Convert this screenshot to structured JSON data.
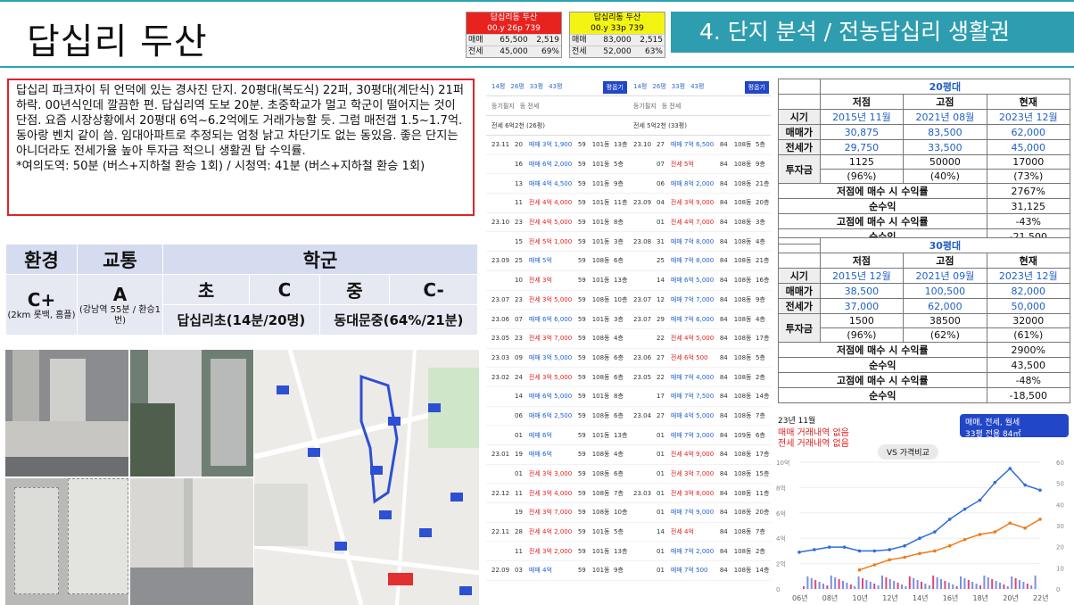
{
  "header": {
    "title": "답십리 두산",
    "section": "4. 단지 분석 / 전농답십리 생활권"
  },
  "mini_cards": [
    {
      "name": "답십리동 두산",
      "info": "00.y  26p  739",
      "rows": [
        [
          "매매",
          "65,500",
          "2,519"
        ],
        [
          "전세",
          "45,000",
          "69%"
        ]
      ],
      "color": "#e8231f",
      "text": "#ffffff"
    },
    {
      "name": "답십리동 두산",
      "info": "00.y  33p  739",
      "rows": [
        [
          "매매",
          "83,000",
          "2,515"
        ],
        [
          "전세",
          "52,000",
          "63%"
        ]
      ],
      "color": "#f4f413",
      "text": "#000000"
    }
  ],
  "description": "답십리 파크자이 뒤 언덕에 있는 경사진 단지. 20평대(복도식) 22퍼, 30평대(계단식) 21퍼 하락. 00년식인데 깔끔한 편. 답십리역 도보 20분. 초중학교가 멀고 학군이 떨어지는 것이 단점. 요즘 시장상황에서 20평대 6억~6.2억에도 거래가능할 듯. 그럼 매전갭 1.5~1.7억. 동아랑 벤치 같이 씀. 임대아파트로 추정되는 엄청 낡고 차단기도 없는 동있음. 좋은 단지는 아니더라도 전세가율 높아 투자금 적으니 생활권 탑 수익률.",
  "commute": "*여의도역: 50분 (버스+지하철 환승 1회) / 시청역: 41분 (버스+지하철 환승 1회)",
  "env_table": {
    "headers": [
      "환경",
      "교통",
      "학군"
    ],
    "grades": {
      "env": "C+",
      "traffic": "A",
      "elem": "초",
      "elem_grade": "C",
      "mid": "중",
      "mid_grade": "C-"
    },
    "env_note": "(2km 롯백, 홈플)",
    "traffic_note": "(강남역 55분 / 환승1번)",
    "elem_school": "답십리초(14분/20명)",
    "mid_school": "동대문중(64%/21분)"
  },
  "transactions": [
    {
      "tabs": [
        "14평",
        "26평",
        "33평",
        "43평"
      ],
      "units": [
        "-세대",
        "203세대",
        "322세대",
        "174세대"
      ],
      "button": "평옵기",
      "filters": [
        "등기필지",
        "등 전세"
      ],
      "label": "전세 6억2천 (26평)",
      "rows": [
        [
          "23.11",
          "20",
          "매매 3억 1,900",
          "59",
          "101동",
          "13층"
        ],
        [
          "",
          "16",
          "매매 6억 2,000",
          "59",
          "101동",
          "5층"
        ],
        [
          "",
          "13",
          "매매 4억 4,500",
          "59",
          "101동",
          "9층"
        ],
        [
          "",
          "11",
          "전세 4억 4,000",
          "59",
          "101동",
          "11층"
        ],
        [
          "23.10",
          "23",
          "전세 4억 5,000",
          "59",
          "101동",
          "8층"
        ],
        [
          "",
          "15",
          "전세 5억 1,000",
          "59",
          "101동",
          "3층"
        ],
        [
          "23.09",
          "25",
          "매매 5억",
          "59",
          "108동",
          "6층"
        ],
        [
          "",
          "10",
          "전세 3억",
          "59",
          "101동",
          "13층"
        ],
        [
          "23.07",
          "23",
          "전세 3억 5,000",
          "59",
          "108동",
          "10층"
        ],
        [
          "23.06",
          "07",
          "매매 6억 6,000",
          "59",
          "101동",
          "3층"
        ],
        [
          "23.05",
          "23",
          "전세 3억 7,000",
          "59",
          "108동",
          "4층"
        ],
        [
          "23.03",
          "09",
          "매매 3억 5,000",
          "59",
          "108동",
          "6층"
        ],
        [
          "23.02",
          "24",
          "전세 3억 5,000",
          "59",
          "108동",
          "6층"
        ],
        [
          "",
          "14",
          "매매 6억 5,000",
          "59",
          "101동",
          "8층"
        ],
        [
          "",
          "06",
          "매매 6억 2,500",
          "59",
          "108동",
          "6층"
        ],
        [
          "",
          "01",
          "매매 6억",
          "59",
          "101동",
          "13층"
        ],
        [
          "23.01",
          "19",
          "매매 6억",
          "59",
          "108동",
          "4층"
        ],
        [
          "",
          "01",
          "전세 3억 3,000",
          "59",
          "108동",
          "6층"
        ],
        [
          "22.12",
          "11",
          "전세 3억 4,000",
          "59",
          "108동",
          "7층"
        ],
        [
          "",
          "19",
          "전세 3억 7,000",
          "59",
          "108동",
          "10층"
        ],
        [
          "22.11",
          "28",
          "전세 4억 2,000",
          "59",
          "101동",
          "5층"
        ],
        [
          "",
          "11",
          "전세 3억 2,000",
          "59",
          "101동",
          "13층"
        ],
        [
          "22.09",
          "03",
          "매매 4억",
          "59",
          "101동",
          "9층"
        ]
      ]
    },
    {
      "tabs": [
        "14평",
        "26평",
        "33평",
        "43평"
      ],
      "units": [
        "-세대",
        "203세대",
        "322세대",
        "174세대"
      ],
      "button": "평옵기",
      "filters": [
        "등기필지",
        "등 전세"
      ],
      "label": "전세 5억2천 (33평)",
      "rows": [
        [
          "23.10",
          "27",
          "매매 7억 6,500",
          "84",
          "108동",
          "5층"
        ],
        [
          "",
          "07",
          "전세 5억",
          "84",
          "108동",
          "9층"
        ],
        [
          "",
          "06",
          "매매 8억 2,000",
          "84",
          "108동",
          "21층"
        ],
        [
          "23.09",
          "04",
          "전세 3억 9,000",
          "84",
          "108동",
          "20층"
        ],
        [
          "",
          "01",
          "전세 4억 7,000",
          "84",
          "108동",
          "3층"
        ],
        [
          "23.08",
          "31",
          "매매 7억 8,000",
          "84",
          "108동",
          "4층"
        ],
        [
          "",
          "25",
          "매매 7억 8,000",
          "84",
          "108동",
          "21층"
        ],
        [
          "",
          "14",
          "매매 6억 5,000",
          "84",
          "108동",
          "16층"
        ],
        [
          "23.07",
          "12",
          "매매 7억 7,000",
          "84",
          "108동",
          "9층"
        ],
        [
          "23.07",
          "29",
          "매매 7억 6,000",
          "84",
          "108동",
          "4층"
        ],
        [
          "",
          "22",
          "전세 4억 5,000",
          "84",
          "108동",
          "17층"
        ],
        [
          "23.06",
          "27",
          "전세 6억 500",
          "84",
          "108동",
          "5층"
        ],
        [
          "23.05",
          "22",
          "매매 7억 4,000",
          "84",
          "108동",
          "2층"
        ],
        [
          "",
          "17",
          "매매 7억 7,500",
          "84",
          "108동",
          "14층"
        ],
        [
          "23.04",
          "27",
          "매매 4억 5,000",
          "84",
          "108동",
          "7층"
        ],
        [
          "",
          "01",
          "매매 7억 3,000",
          "84",
          "109동",
          "6층"
        ],
        [
          "",
          "01",
          "전세 4억 9,000",
          "84",
          "108동",
          "17층"
        ],
        [
          "",
          "01",
          "전세 3억 7,000",
          "84",
          "108동",
          "15층"
        ],
        [
          "23.03",
          "01",
          "전세 3억 8,000",
          "84",
          "108동",
          "11층"
        ],
        [
          "",
          "01",
          "매매 7억 9,000",
          "84",
          "108동",
          "20층"
        ],
        [
          "",
          "14",
          "전세 4억",
          "84",
          "108동",
          "7층"
        ],
        [
          "",
          "01",
          "매매 7억 2,000",
          "84",
          "108동",
          "2층"
        ],
        [
          "",
          "01",
          "매매 7억 500",
          "84",
          "108동",
          "14층"
        ]
      ]
    }
  ],
  "price_tables": [
    {
      "caption": "20평대",
      "cols": [
        "저점",
        "고점",
        "현재"
      ],
      "times": [
        "2015년 11월",
        "2021년 08월",
        "2023년 12월"
      ],
      "sale": [
        "30,875",
        "83,500",
        "62,000"
      ],
      "jeonse": [
        "29,750",
        "33,500",
        "45,000"
      ],
      "invest": [
        "1125",
        "50000",
        "17000"
      ],
      "invest_pct": [
        "(96%)",
        "(40%)",
        "(73%)"
      ],
      "low_yield_label": "저점에 매수 시 수익률",
      "low_yield": "2767%",
      "low_net_label": "순수익",
      "low_net": "31,125",
      "high_yield_label": "고점에 매수 시 수익률",
      "high_yield": "-43%",
      "high_net_label": "순수익",
      "high_net": "-21,500"
    },
    {
      "caption": "30평대",
      "cols": [
        "저점",
        "고점",
        "현재"
      ],
      "times": [
        "2015년 12월",
        "2021년 09월",
        "2023년 12월"
      ],
      "sale": [
        "38,500",
        "100,500",
        "82,000"
      ],
      "jeonse": [
        "37,000",
        "62,000",
        "50,000"
      ],
      "invest": [
        "1500",
        "38500",
        "32000"
      ],
      "invest_pct": [
        "(96%)",
        "(62%)",
        "(61%)"
      ],
      "low_yield_label": "저점에 매수 시 수익률",
      "low_yield": "2900%",
      "low_net_label": "순수익",
      "low_net": "43,500",
      "high_yield_label": "고점에 매수 시 수익률",
      "high_yield": "-48%",
      "high_net_label": "순수익",
      "high_net": "-18,500"
    }
  ],
  "row_labels": {
    "time": "시기",
    "sale": "매매가",
    "jeonse": "전세가",
    "invest": "투자금"
  },
  "chart_labels": {
    "date": "23년 11월",
    "no_sale": "매매 거래내역 없음",
    "no_jeonse": "전세 거래내역 없음",
    "filter": "매매, 전세, 월세",
    "size": "33평",
    "size_sub": "전용 84㎡",
    "compare": "VS 가격비교"
  },
  "chart_data": {
    "type": "line",
    "x": [
      "06년",
      "08년",
      "10년",
      "12년",
      "14년",
      "16년",
      "18년",
      "20년",
      "22년"
    ],
    "y_left": [
      "0",
      "2억",
      "4억",
      "6억",
      "8억",
      "10억"
    ],
    "y_right": [
      "0",
      "10",
      "20",
      "30",
      "40",
      "50",
      "60"
    ],
    "series": [
      {
        "color": "#2f6fd8",
        "values": [
          2.9,
          3.1,
          3.3,
          3.3,
          3.0,
          3.0,
          3.1,
          3.4,
          4.0,
          4.5,
          5.5,
          6.3,
          7.0,
          8.4,
          9.5,
          8.2,
          7.8
        ]
      },
      {
        "color": "#f07a1a",
        "values": [
          null,
          null,
          null,
          null,
          1.5,
          1.9,
          2.3,
          2.5,
          2.8,
          3.0,
          3.4,
          3.9,
          4.3,
          4.5,
          5.2,
          4.8,
          5.5
        ]
      }
    ]
  }
}
